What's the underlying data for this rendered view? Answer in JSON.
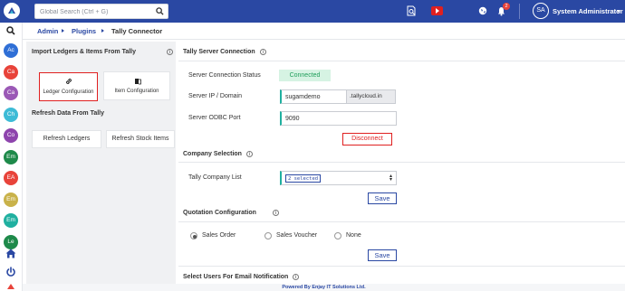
{
  "search": {
    "placeholder": "Global Search (Ctrl + G)"
  },
  "header": {
    "user_initials": "SA",
    "user_name": "System Administrator",
    "notification_count": "2"
  },
  "sidebar": {
    "avatars": [
      {
        "label": "Ac",
        "color": "#2f6fd6"
      },
      {
        "label": "Ca",
        "color": "#e8433a"
      },
      {
        "label": "Ca",
        "color": "#9b59b6"
      },
      {
        "label": "Ch",
        "color": "#3dbbd6"
      },
      {
        "label": "Co",
        "color": "#8e44ad"
      },
      {
        "label": "Em",
        "color": "#1e8a4a"
      },
      {
        "label": "EA",
        "color": "#e8433a"
      },
      {
        "label": "Em",
        "color": "#c9b24a"
      },
      {
        "label": "Em",
        "color": "#20b0a0"
      },
      {
        "label": "Le",
        "color": "#1e8a4a"
      }
    ]
  },
  "breadcrumb": {
    "admin": "Admin",
    "plugins": "Plugins",
    "current": "Tally Connector"
  },
  "left": {
    "import_title": "Import Ledgers & Items From Tally",
    "ledger_config": "Ledger Configuration",
    "item_config": "Item Configuration",
    "refresh_title": "Refresh Data From Tally",
    "refresh_ledgers": "Refresh Ledgers",
    "refresh_stock": "Refresh Stock Items"
  },
  "server": {
    "title": "Tally Server Connection",
    "status_label": "Server Connection Status",
    "status_value": "Connected",
    "ip_label": "Server IP / Domain",
    "ip_value": "sugamdemo",
    "ip_suffix": ".tallycloud.in",
    "port_label": "Server ODBC Port",
    "port_value": "9090",
    "disconnect": "Disconnect"
  },
  "company": {
    "title": "Company Selection",
    "list_label": "Tally Company List",
    "selected": "2 selected",
    "save": "Save"
  },
  "quotation": {
    "title": "Quotation Configuration",
    "options": [
      "Sales Order",
      "Sales Voucher",
      "None"
    ],
    "selected_index": 0,
    "save": "Save"
  },
  "email": {
    "title": "Select Users For Email Notification"
  },
  "footer": {
    "text": "Powered By Enjay IT Solutions Ltd."
  },
  "colors": {
    "brand": "#2a48a3",
    "danger": "#e02020",
    "success": "#1f9e5a",
    "accent": "#20b0a0"
  }
}
